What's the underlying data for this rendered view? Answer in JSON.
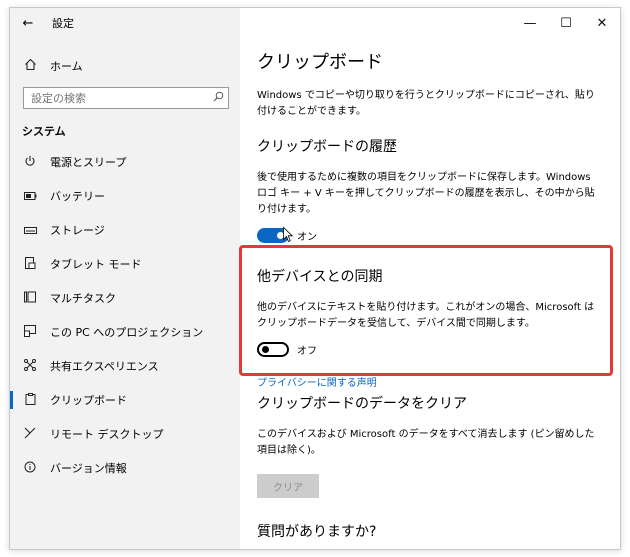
{
  "window": {
    "title": "設定",
    "back_glyph": "←",
    "controls": {
      "minimize": "—",
      "maximize": "☐",
      "close": "✕"
    }
  },
  "sidebar": {
    "home": {
      "icon": "home-icon",
      "label": "ホーム"
    },
    "search": {
      "placeholder": "設定の検索",
      "icon": "search-icon"
    },
    "section": "システム",
    "items": [
      {
        "icon": "power-icon",
        "label": "電源とスリープ",
        "selected": false
      },
      {
        "icon": "battery-icon",
        "label": "バッテリー",
        "selected": false
      },
      {
        "icon": "storage-icon",
        "label": "ストレージ",
        "selected": false
      },
      {
        "icon": "tablet-icon",
        "label": "タブレット モード",
        "selected": false
      },
      {
        "icon": "multitask-icon",
        "label": "マルチタスク",
        "selected": false
      },
      {
        "icon": "project-icon",
        "label": "この PC へのプロジェクション",
        "selected": false
      },
      {
        "icon": "shared-experience-icon",
        "label": "共有エクスペリエンス",
        "selected": false
      },
      {
        "icon": "clipboard-icon",
        "label": "クリップボード",
        "selected": true
      },
      {
        "icon": "remote-desktop-icon",
        "label": "リモート デスクトップ",
        "selected": false
      },
      {
        "icon": "info-icon",
        "label": "バージョン情報",
        "selected": false
      }
    ]
  },
  "main": {
    "title": "クリップボード",
    "intro": "Windows でコピーや切り取りを行うとクリップボードにコピーされ、貼り付けることができます。",
    "history": {
      "heading": "クリップボードの履歴",
      "description": "後で使用するために複数の項目をクリップボードに保存します。Windows ロゴ キー + V キーを押してクリップボードの履歴を表示し、その中から貼り付けます。",
      "toggle_state": "on",
      "toggle_label": "オン"
    },
    "sync": {
      "heading": "他デバイスとの同期",
      "description": "他のデバイスにテキストを貼り付けます。これがオンの場合、Microsoft はクリップボードデータを受信して、デバイス間で同期します。",
      "toggle_state": "off",
      "toggle_label": "オフ",
      "privacy_link": "プライバシーに関する声明"
    },
    "clear": {
      "heading": "クリップボードのデータをクリア",
      "description": "このデバイスおよび Microsoft のデータをすべて消去します (ピン留めした項目は除く)。",
      "button_label": "クリア"
    },
    "questions_heading": "質問がありますか?"
  },
  "colors": {
    "accent": "#0a66c2",
    "highlight": "#e53935",
    "sidebar_bg": "#f2f2f2"
  }
}
